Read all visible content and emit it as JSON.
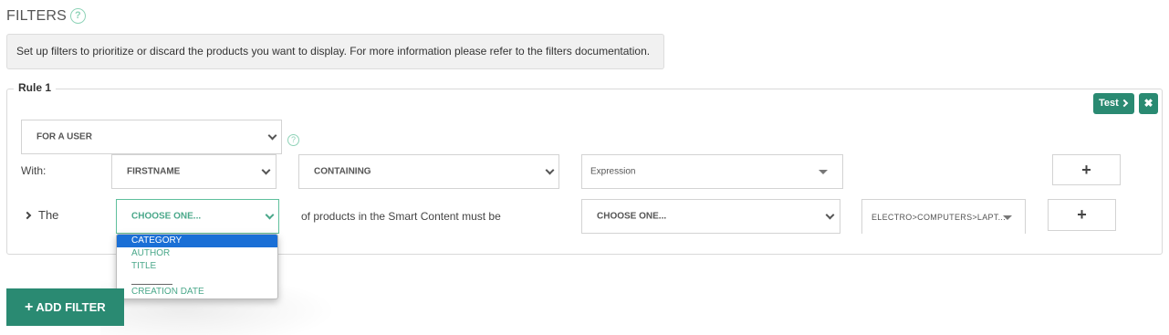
{
  "header": {
    "title": "FILTERS",
    "help_glyph": "?",
    "info_text": "Set up filters to prioritize or discard the products you want to display. For more information please refer to the filters documentation."
  },
  "rule": {
    "legend": "Rule 1",
    "test_label": "Test",
    "delete_glyph": "✖",
    "user_select": {
      "value": "FOR A USER"
    },
    "user_help_glyph": "?",
    "with_label": "With:",
    "attribute_select": {
      "value": "FIRSTNAME"
    },
    "operator_select": {
      "value": "CONTAINING"
    },
    "value_select": {
      "value": "Expression"
    },
    "add_condition_glyph": "+",
    "the_label": "The",
    "field_select": {
      "value": "CHOOSE ONE..."
    },
    "middle_text": "of products in the Smart Content must be",
    "constraint_select": {
      "value": "CHOOSE ONE..."
    },
    "category_select": {
      "value": "ELECTRO>COMPUTERS>LAPT..."
    },
    "add_product_condition_glyph": "+"
  },
  "field_dropdown": {
    "options": [
      "CATEGORY",
      "AUTHOR",
      "TITLE",
      "CREATION DATE"
    ],
    "selected": "CATEGORY"
  },
  "footer": {
    "add_filter_plus": "+",
    "add_filter_label": "ADD FILTER"
  },
  "colors": {
    "accent": "#2a8a72",
    "help": "#8fd3b8",
    "dropdown_selected": "#1a6fd6",
    "dropdown_text": "#4aa88a"
  }
}
